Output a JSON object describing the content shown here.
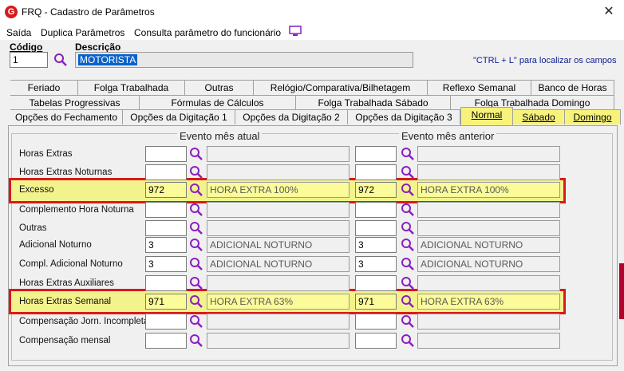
{
  "window": {
    "title": "FRQ - Cadastro de Parâmetros",
    "app_icon": "G",
    "close_label": "✕"
  },
  "menu": {
    "items": [
      "Saída",
      "Duplica Parâmetros",
      "Consulta parâmetro do funcionário"
    ]
  },
  "form": {
    "codigo_label": "Código",
    "codigo_value": "1",
    "descricao_label": "Descrição",
    "descricao_value": "MOTORISTA",
    "hint": "\"CTRL + L\" para localizar os campos"
  },
  "tabs": {
    "row1": [
      "Feriado",
      "Folga Trabalhada",
      "Outras",
      "Relógio/Comparativa/Bilhetagem",
      "Reflexo Semanal",
      "Banco de Horas"
    ],
    "row2": [
      "Tabelas Progressivas",
      "Fórmulas de Cálculos",
      "Folga Trabalhada Sábado",
      "Folga Trabalhada Domingo"
    ],
    "row3": [
      "Opções do Fechamento",
      "Opções da Digitação 1",
      "Opções da Digitação 2",
      "Opções da Digitação 3",
      "Normal",
      "Sábado",
      "Domingo"
    ]
  },
  "groups": {
    "current": "Evento mês atual",
    "previous": "Evento mês anterior"
  },
  "rows": [
    {
      "label": "Horas Extras",
      "cur_code": "",
      "cur_desc": "",
      "prev_code": "",
      "prev_desc": ""
    },
    {
      "label": "Horas Extras Noturnas",
      "cur_code": "",
      "cur_desc": "",
      "prev_code": "",
      "prev_desc": ""
    },
    {
      "label": "Excesso",
      "cur_code": "972",
      "cur_desc": "HORA EXTRA 100%",
      "prev_code": "972",
      "prev_desc": "HORA EXTRA 100%"
    },
    {
      "label": "Complemento Hora Noturna",
      "cur_code": "",
      "cur_desc": "",
      "prev_code": "",
      "prev_desc": ""
    },
    {
      "label": "Outras",
      "cur_code": "",
      "cur_desc": "",
      "prev_code": "",
      "prev_desc": ""
    },
    {
      "label": "Adicional Noturno",
      "cur_code": "3",
      "cur_desc": "ADICIONAL NOTURNO",
      "prev_code": "3",
      "prev_desc": "ADICIONAL NOTURNO"
    },
    {
      "label": "Compl. Adicional Noturno",
      "cur_code": "3",
      "cur_desc": "ADICIONAL NOTURNO",
      "prev_code": "3",
      "prev_desc": "ADICIONAL NOTURNO"
    },
    {
      "label": "Horas Extras Auxiliares",
      "cur_code": "",
      "cur_desc": "",
      "prev_code": "",
      "prev_desc": ""
    },
    {
      "label": "Horas Extras Semanal",
      "cur_code": "971",
      "cur_desc": "HORA EXTRA 63%",
      "prev_code": "971",
      "prev_desc": "HORA EXTRA 63%"
    },
    {
      "label": "Compensação Jorn. Incompleta",
      "cur_code": "",
      "cur_desc": "",
      "prev_code": "",
      "prev_desc": ""
    },
    {
      "label": "Compensação mensal",
      "cur_code": "",
      "cur_desc": "",
      "prev_code": "",
      "prev_desc": ""
    }
  ],
  "colors": {
    "highlight_border": "#d81a1a",
    "highlight_fill": "#f3f38d",
    "magnifier": "#8a1fc0",
    "selection": "#0a62c8"
  }
}
